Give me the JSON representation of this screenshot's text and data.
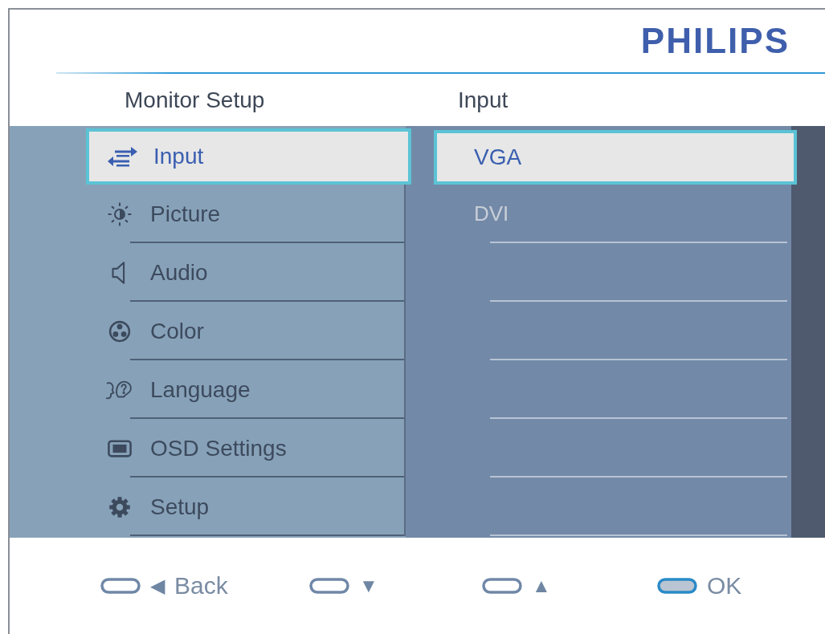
{
  "brand": "PHILIPS",
  "menu": {
    "title": "Monitor Setup",
    "items": [
      {
        "label": "Input",
        "kind": "input",
        "selected": true
      },
      {
        "label": "Picture",
        "kind": "picture",
        "selected": false
      },
      {
        "label": "Audio",
        "kind": "audio",
        "selected": false
      },
      {
        "label": "Color",
        "kind": "color",
        "selected": false
      },
      {
        "label": "Language",
        "kind": "language",
        "selected": false
      },
      {
        "label": "OSD Settings",
        "kind": "osd",
        "selected": false
      },
      {
        "label": "Setup",
        "kind": "setup",
        "selected": false
      }
    ]
  },
  "submenu": {
    "title": "Input",
    "options": [
      {
        "label": "VGA",
        "selected": true
      },
      {
        "label": "DVI",
        "selected": false
      }
    ]
  },
  "keys": [
    {
      "arrow": "◀",
      "label": "Back",
      "highlighted": false
    },
    {
      "arrow": "▼",
      "highlighted": false
    },
    {
      "arrow": "▲",
      "highlighted": false
    },
    {
      "label": "OK",
      "highlighted": true
    }
  ]
}
